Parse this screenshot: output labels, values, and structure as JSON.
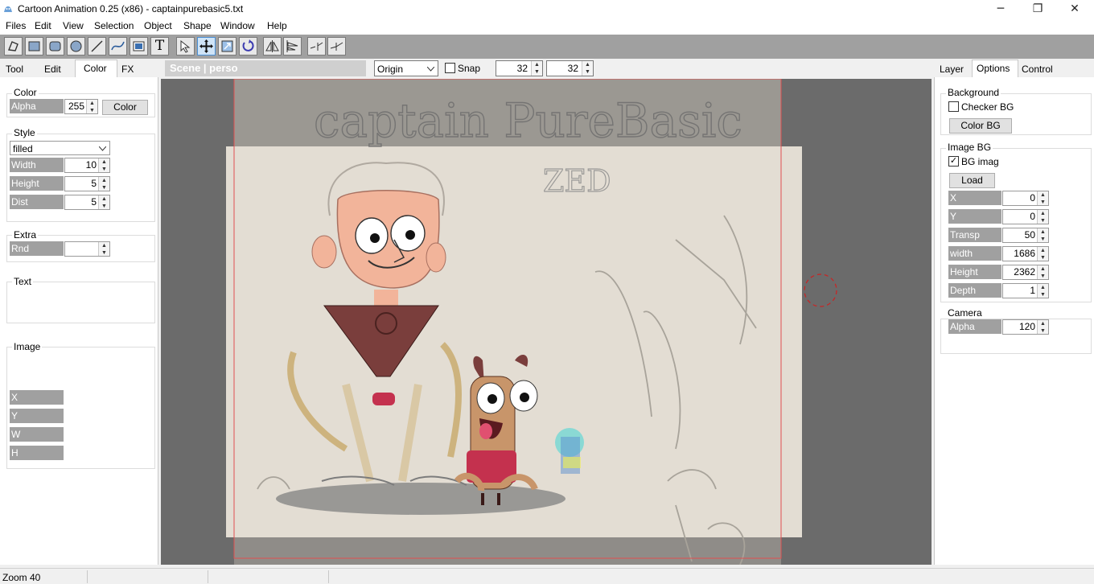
{
  "window": {
    "title": "Cartoon Animation 0.25 (x86) - captainpurebasic5.txt",
    "minimize_glyph": "─",
    "maximize_glyph": "❐",
    "close_glyph": "✕"
  },
  "menu": [
    "Files",
    "Edit",
    "View",
    "Selection",
    "Object",
    "Shape",
    "Window",
    "Help"
  ],
  "toolbar": {
    "tools": [
      "polygon-tool-icon",
      "rectangle-tool-icon",
      "rounded-rect-tool-icon",
      "ellipse-tool-icon",
      "line-tool-icon",
      "curve-tool-icon",
      "image-tool-icon",
      "text-tool-icon",
      "select-tool-icon",
      "move-tool-icon",
      "scale-tool-icon",
      "rotate-tool-icon",
      "flip-horizontal-icon",
      "align-icon",
      "break-path-icon",
      "join-path-icon"
    ],
    "text_tool_glyph": "T",
    "accent_color": "#4a8fd4"
  },
  "left_tabs": [
    "Tool",
    "Edit",
    "Color",
    "FX"
  ],
  "left_active_tab": "Color",
  "right_tabs": [
    "Layer",
    "Options",
    "Control"
  ],
  "right_active_tab": "Options",
  "scene": {
    "label": "Scene | perso",
    "origin": "Origin",
    "snap_label": "Snap",
    "snap_x": "32",
    "snap_y": "32"
  },
  "left_panel": {
    "color_group": "Color",
    "alpha_label": "Alpha",
    "alpha_value": "255",
    "color_button": "Color",
    "style_group": "Style",
    "style_value": "filled",
    "width_label": "Width",
    "width_value": "10",
    "height_label": "Height",
    "height_value": "5",
    "dist_label": "Dist",
    "dist_value": "5",
    "extra_group": "Extra",
    "rnd_label": "Rnd",
    "rnd_value": "",
    "text_group": "Text",
    "image_group": "Image",
    "x_label": "X",
    "y_label": "Y",
    "w_label": "W",
    "h_label": "H"
  },
  "right_panel": {
    "background_group": "Background",
    "checker_bg_label": "Checker BG",
    "checker_bg_checked": false,
    "color_bg_button": "Color BG",
    "image_bg_group": "Image BG",
    "bg_image_label": "BG imag",
    "bg_image_checked": true,
    "load_button": "Load",
    "x_label": "X",
    "x_value": "0",
    "y_label": "Y",
    "y_value": "0",
    "transp_label": "Transp",
    "transp_value": "50",
    "width_label": "width",
    "width_value": "1686",
    "height_label": "Height",
    "height_value": "2362",
    "depth_label": "Depth",
    "depth_value": "1",
    "camera_group": "Camera",
    "camera_alpha_label": "Alpha",
    "camera_alpha_value": "120"
  },
  "canvas": {
    "sketch_title": "captain PureBasic",
    "sketch_zed": "ZED",
    "red_guide_color": "#e05050"
  },
  "status": {
    "zoom": "Zoom 40"
  }
}
